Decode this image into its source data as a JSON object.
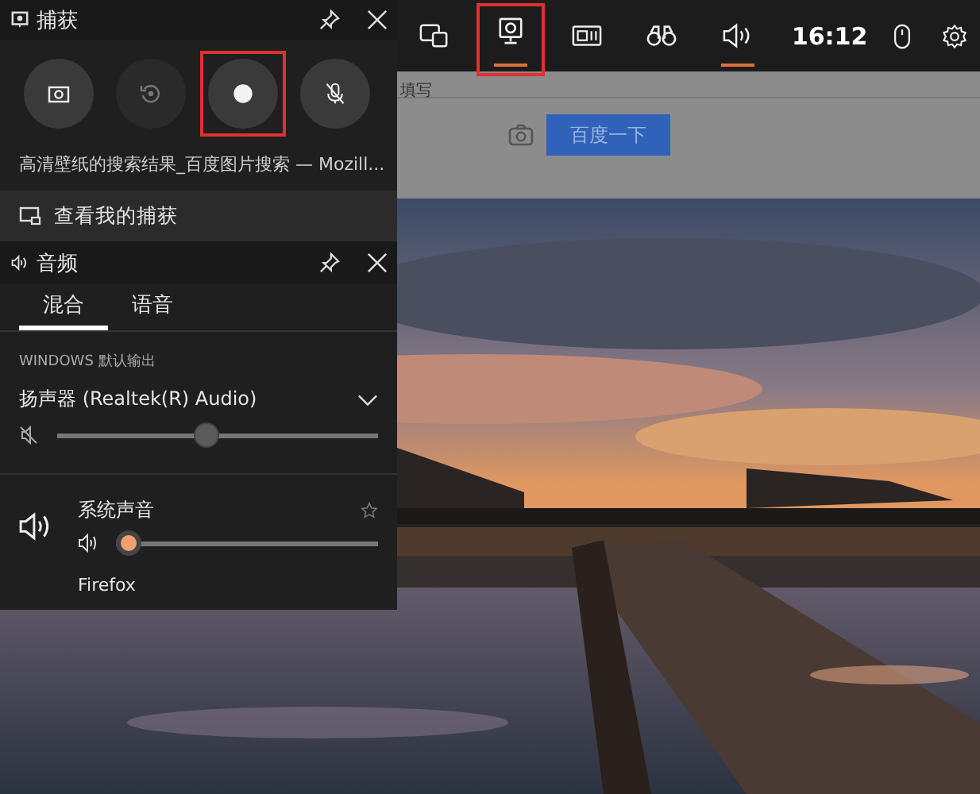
{
  "top_bar": {
    "widgets": [
      {
        "kind": "devices",
        "selected": false,
        "highlighted": false
      },
      {
        "kind": "capture",
        "selected": true,
        "highlighted": true
      },
      {
        "kind": "performance",
        "selected": false,
        "highlighted": false
      },
      {
        "kind": "looking",
        "selected": false,
        "highlighted": false
      },
      {
        "kind": "audio",
        "selected": true,
        "highlighted": false
      }
    ],
    "clock": "16:12",
    "tools": [
      {
        "kind": "mouse"
      },
      {
        "kind": "settings"
      }
    ]
  },
  "browser": {
    "field_label": "填写",
    "search_button": "百度一下"
  },
  "capture": {
    "title": "捕获",
    "buttons": [
      {
        "kind": "screenshot",
        "disabled": false,
        "highlighted": false
      },
      {
        "kind": "replay",
        "disabled": true,
        "highlighted": false
      },
      {
        "kind": "record",
        "disabled": false,
        "highlighted": true
      },
      {
        "kind": "mic",
        "disabled": false,
        "highlighted": false
      }
    ],
    "caption": "高清壁纸的搜索结果_百度图片搜索 — Mozill...",
    "link": "查看我的捕获"
  },
  "audio": {
    "title": "音频",
    "tabs": [
      {
        "label": "混合",
        "selected": true
      },
      {
        "label": "语音",
        "selected": false
      }
    ],
    "section": "WINDOWS 默认输出",
    "device": "扬声器 (Realtek(R) Audio)",
    "master": {
      "muted": true,
      "level": 0.46
    },
    "apps": [
      {
        "name": "系统声音",
        "level": 0,
        "favorite": false
      }
    ],
    "next_app": "Firefox"
  }
}
